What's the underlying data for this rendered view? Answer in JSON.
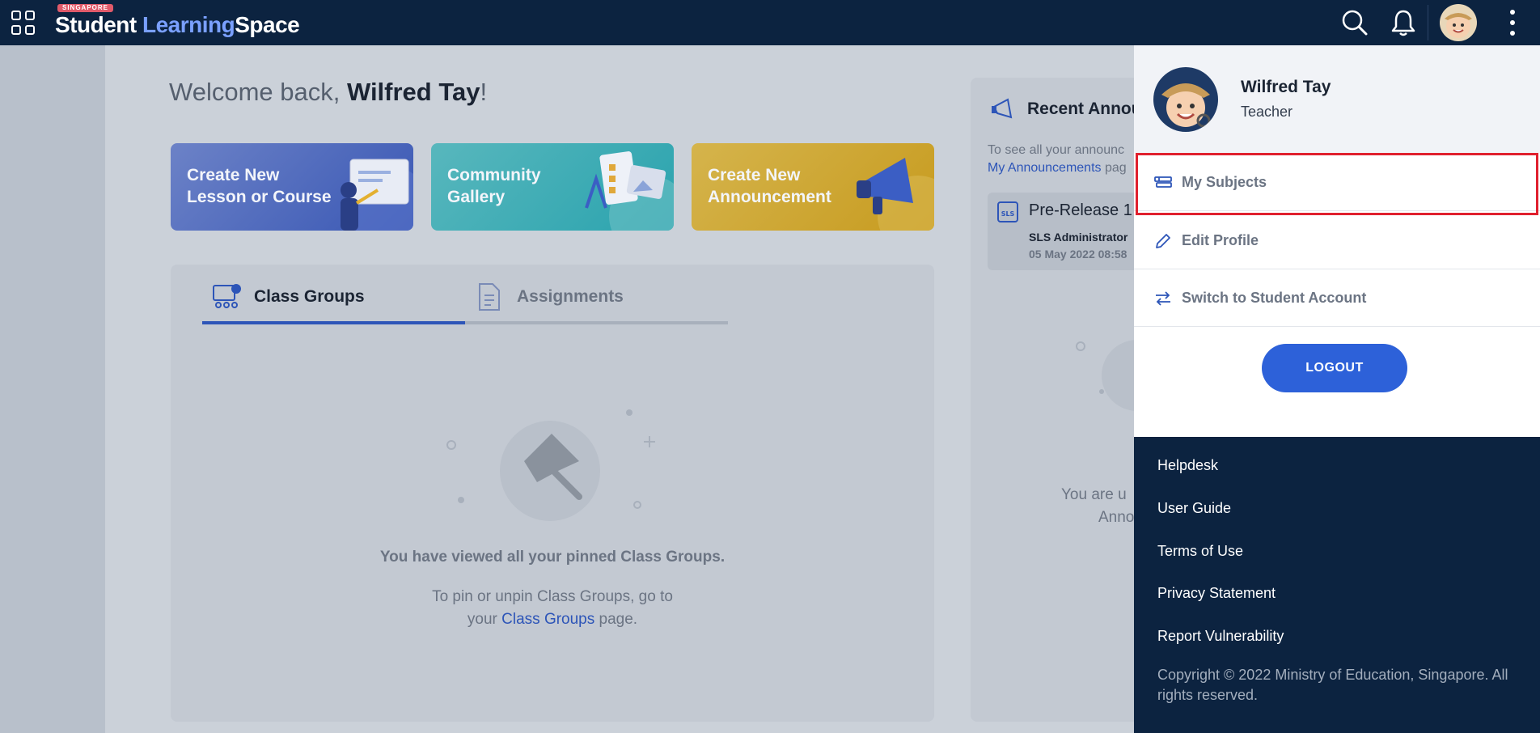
{
  "header": {
    "logo_country": "SINGAPORE",
    "logo_word1": "Student",
    "logo_word2": "Learning",
    "logo_word3": "Space"
  },
  "welcome": {
    "prefix": "Welcome back, ",
    "name": "Wilfred Tay",
    "suffix": "!"
  },
  "quick_cards": [
    {
      "label": "Create New Lesson or Course",
      "icon": "whiteboard-teacher-icon",
      "color": "#3957b4"
    },
    {
      "label": "Community Gallery",
      "icon": "gallery-checklist-icon",
      "color": "#2aa3ae"
    },
    {
      "label": "Create New Announcement",
      "icon": "megaphone-icon",
      "color": "#c79b1f"
    }
  ],
  "tabs": [
    {
      "label": "Class Groups",
      "icon": "class-group-icon",
      "active": true
    },
    {
      "label": "Assignments",
      "icon": "assignment-doc-icon",
      "active": false
    }
  ],
  "empty_state": {
    "title": "You have viewed all your pinned Class Groups.",
    "text_before": "To pin or unpin Class Groups, go to",
    "text_your": "your ",
    "link": "Class Groups",
    "text_after": " page.",
    "icon": "pushpin-icon"
  },
  "announcements": {
    "title": "Recent Annou",
    "sub_line1": "To see all your announc",
    "sub_link": "My Announcements",
    "sub_after": " pag",
    "card_title": "Pre-Release 1",
    "card_by": "SLS Administrator",
    "card_date": "05 May 2022 08:58",
    "empty_line1": "You are u",
    "empty_line2": "Anno"
  },
  "drawer": {
    "user_name": "Wilfred Tay",
    "user_role": "Teacher",
    "menu": [
      {
        "label": "My Subjects",
        "icon": "subjects-icon",
        "highlighted": true
      },
      {
        "label": "Edit Profile",
        "icon": "pencil-icon",
        "highlighted": false
      },
      {
        "label": "Switch to Student Account",
        "icon": "switch-arrows-icon",
        "highlighted": false
      }
    ],
    "logout_label": "LOGOUT",
    "footer_links": [
      "Helpdesk",
      "User Guide",
      "Terms of Use",
      "Privacy Statement",
      "Report Vulnerability"
    ],
    "copyright": "Copyright © 2022 Ministry of Education, Singapore. All rights reserved."
  },
  "colors": {
    "navy": "#0c2340",
    "accent_blue": "#2d61d9",
    "highlight_red": "#e0202e"
  }
}
